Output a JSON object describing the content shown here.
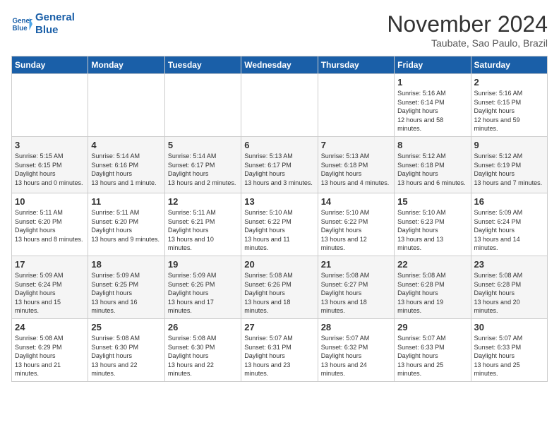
{
  "header": {
    "logo_line1": "General",
    "logo_line2": "Blue",
    "month": "November 2024",
    "location": "Taubate, Sao Paulo, Brazil"
  },
  "days_of_week": [
    "Sunday",
    "Monday",
    "Tuesday",
    "Wednesday",
    "Thursday",
    "Friday",
    "Saturday"
  ],
  "weeks": [
    [
      {
        "num": "",
        "sunrise": "",
        "sunset": "",
        "daylight": ""
      },
      {
        "num": "",
        "sunrise": "",
        "sunset": "",
        "daylight": ""
      },
      {
        "num": "",
        "sunrise": "",
        "sunset": "",
        "daylight": ""
      },
      {
        "num": "",
        "sunrise": "",
        "sunset": "",
        "daylight": ""
      },
      {
        "num": "",
        "sunrise": "",
        "sunset": "",
        "daylight": ""
      },
      {
        "num": "1",
        "sunrise": "5:16 AM",
        "sunset": "6:14 PM",
        "daylight": "12 hours and 58 minutes."
      },
      {
        "num": "2",
        "sunrise": "5:16 AM",
        "sunset": "6:15 PM",
        "daylight": "12 hours and 59 minutes."
      }
    ],
    [
      {
        "num": "3",
        "sunrise": "5:15 AM",
        "sunset": "6:15 PM",
        "daylight": "13 hours and 0 minutes."
      },
      {
        "num": "4",
        "sunrise": "5:14 AM",
        "sunset": "6:16 PM",
        "daylight": "13 hours and 1 minute."
      },
      {
        "num": "5",
        "sunrise": "5:14 AM",
        "sunset": "6:17 PM",
        "daylight": "13 hours and 2 minutes."
      },
      {
        "num": "6",
        "sunrise": "5:13 AM",
        "sunset": "6:17 PM",
        "daylight": "13 hours and 3 minutes."
      },
      {
        "num": "7",
        "sunrise": "5:13 AM",
        "sunset": "6:18 PM",
        "daylight": "13 hours and 4 minutes."
      },
      {
        "num": "8",
        "sunrise": "5:12 AM",
        "sunset": "6:18 PM",
        "daylight": "13 hours and 6 minutes."
      },
      {
        "num": "9",
        "sunrise": "5:12 AM",
        "sunset": "6:19 PM",
        "daylight": "13 hours and 7 minutes."
      }
    ],
    [
      {
        "num": "10",
        "sunrise": "5:11 AM",
        "sunset": "6:20 PM",
        "daylight": "13 hours and 8 minutes."
      },
      {
        "num": "11",
        "sunrise": "5:11 AM",
        "sunset": "6:20 PM",
        "daylight": "13 hours and 9 minutes."
      },
      {
        "num": "12",
        "sunrise": "5:11 AM",
        "sunset": "6:21 PM",
        "daylight": "13 hours and 10 minutes."
      },
      {
        "num": "13",
        "sunrise": "5:10 AM",
        "sunset": "6:22 PM",
        "daylight": "13 hours and 11 minutes."
      },
      {
        "num": "14",
        "sunrise": "5:10 AM",
        "sunset": "6:22 PM",
        "daylight": "13 hours and 12 minutes."
      },
      {
        "num": "15",
        "sunrise": "5:10 AM",
        "sunset": "6:23 PM",
        "daylight": "13 hours and 13 minutes."
      },
      {
        "num": "16",
        "sunrise": "5:09 AM",
        "sunset": "6:24 PM",
        "daylight": "13 hours and 14 minutes."
      }
    ],
    [
      {
        "num": "17",
        "sunrise": "5:09 AM",
        "sunset": "6:24 PM",
        "daylight": "13 hours and 15 minutes."
      },
      {
        "num": "18",
        "sunrise": "5:09 AM",
        "sunset": "6:25 PM",
        "daylight": "13 hours and 16 minutes."
      },
      {
        "num": "19",
        "sunrise": "5:09 AM",
        "sunset": "6:26 PM",
        "daylight": "13 hours and 17 minutes."
      },
      {
        "num": "20",
        "sunrise": "5:08 AM",
        "sunset": "6:26 PM",
        "daylight": "13 hours and 18 minutes."
      },
      {
        "num": "21",
        "sunrise": "5:08 AM",
        "sunset": "6:27 PM",
        "daylight": "13 hours and 18 minutes."
      },
      {
        "num": "22",
        "sunrise": "5:08 AM",
        "sunset": "6:28 PM",
        "daylight": "13 hours and 19 minutes."
      },
      {
        "num": "23",
        "sunrise": "5:08 AM",
        "sunset": "6:28 PM",
        "daylight": "13 hours and 20 minutes."
      }
    ],
    [
      {
        "num": "24",
        "sunrise": "5:08 AM",
        "sunset": "6:29 PM",
        "daylight": "13 hours and 21 minutes."
      },
      {
        "num": "25",
        "sunrise": "5:08 AM",
        "sunset": "6:30 PM",
        "daylight": "13 hours and 22 minutes."
      },
      {
        "num": "26",
        "sunrise": "5:08 AM",
        "sunset": "6:30 PM",
        "daylight": "13 hours and 22 minutes."
      },
      {
        "num": "27",
        "sunrise": "5:07 AM",
        "sunset": "6:31 PM",
        "daylight": "13 hours and 23 minutes."
      },
      {
        "num": "28",
        "sunrise": "5:07 AM",
        "sunset": "6:32 PM",
        "daylight": "13 hours and 24 minutes."
      },
      {
        "num": "29",
        "sunrise": "5:07 AM",
        "sunset": "6:33 PM",
        "daylight": "13 hours and 25 minutes."
      },
      {
        "num": "30",
        "sunrise": "5:07 AM",
        "sunset": "6:33 PM",
        "daylight": "13 hours and 25 minutes."
      }
    ]
  ],
  "labels": {
    "sunrise": "Sunrise:",
    "sunset": "Sunset:",
    "daylight": "Daylight:"
  }
}
